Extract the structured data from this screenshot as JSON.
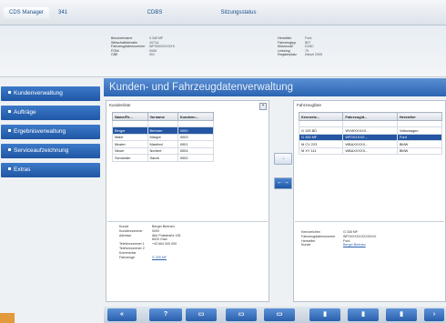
{
  "tabs": [
    {
      "label": "CDS Manager"
    },
    {
      "label": "341"
    },
    {
      "label": "CDBS"
    },
    {
      "label": "Sitzungsstatus"
    }
  ],
  "header": {
    "left": [
      {
        "k": "Benutzername",
        "v": "0.345 MF"
      },
      {
        "k": "Wirtschaftsberatin",
        "v": "1071A"
      },
      {
        "k": "Fahrzeugdatennummer",
        "v": "WF0000XXXXXX"
      },
      {
        "k": "FGNr",
        "v": "0006"
      },
      {
        "k": "CBE",
        "v": "001"
      }
    ],
    "right": [
      {
        "k": "Hersteller",
        "v": "Ford"
      },
      {
        "k": "Fahrzeugtyp",
        "v": "B07"
      },
      {
        "k": "Motorcode",
        "v": "D1BC"
      },
      {
        "k": "Leistung",
        "v": "75"
      },
      {
        "k": "Registerplatz",
        "v": "Diesel 2005"
      }
    ]
  },
  "sidebar": [
    {
      "label": "Kundenverwaltung"
    },
    {
      "label": "Aufträge"
    },
    {
      "label": "Ergebnisverwaltung"
    },
    {
      "label": "Serviceaufzeichnung"
    },
    {
      "label": "Extras"
    }
  ],
  "page_title": "Kunden- und Fahrzeugdatenverwaltung",
  "customers": {
    "title": "Kundenliste",
    "columns": [
      "Name/Fir...",
      "Vorname",
      "Kundenn..."
    ],
    "rows": [
      [
        "Berger",
        "Bertram",
        "0000"
      ],
      [
        "Maier",
        "Margot",
        "0003"
      ],
      [
        "Muster",
        "Manfred",
        "0001"
      ],
      [
        "Neuer",
        "Norbert",
        "0004"
      ],
      [
        "Schneider",
        "Sarah",
        "0002"
      ]
    ],
    "details": [
      {
        "k": "Kunde",
        "v": "Berger Bertram"
      },
      {
        "k": "Kundennummer",
        "v": "0000"
      },
      {
        "k": "Adresse",
        "v": "Alte Poststraße 152"
      },
      {
        "k": "",
        "v": "8020 Graz"
      },
      {
        "k": "Telefonnummer 1",
        "v": "+43 664 000 000"
      },
      {
        "k": "Telefonnummer 2",
        "v": ""
      },
      {
        "k": "Kommentar",
        "v": ""
      },
      {
        "k": "Fahrzeuge",
        "v": "G 325 MF"
      }
    ]
  },
  "vehicles": {
    "title": "Fahrzeugliste",
    "columns": [
      "Kennzeic...",
      "Fahrzeugid...",
      "Hersteller"
    ],
    "rows": [
      [
        "G 125 BD",
        "WVWXXXXX...",
        "Volkswagen"
      ],
      [
        "G 345 MF",
        "WF0XXXXX...",
        "Ford"
      ],
      [
        "M CV 223",
        "WBAXXXXX...",
        "BMW"
      ],
      [
        "M XY 111",
        "WBAXXXXX...",
        "BMW"
      ]
    ],
    "details": [
      {
        "k": "Kennzeichen",
        "v": "G 345 MF"
      },
      {
        "k": "Fahrzeugdatennummer",
        "v": "WF0XXXXXXXXXXXX"
      },
      {
        "k": "Hersteller",
        "v": "Ford"
      },
      {
        "k": "Kunde",
        "v": "Berger Bertram"
      }
    ]
  },
  "buttons": {
    "help": "?",
    "arrow_left": "→",
    "arrow_right": "←→"
  }
}
